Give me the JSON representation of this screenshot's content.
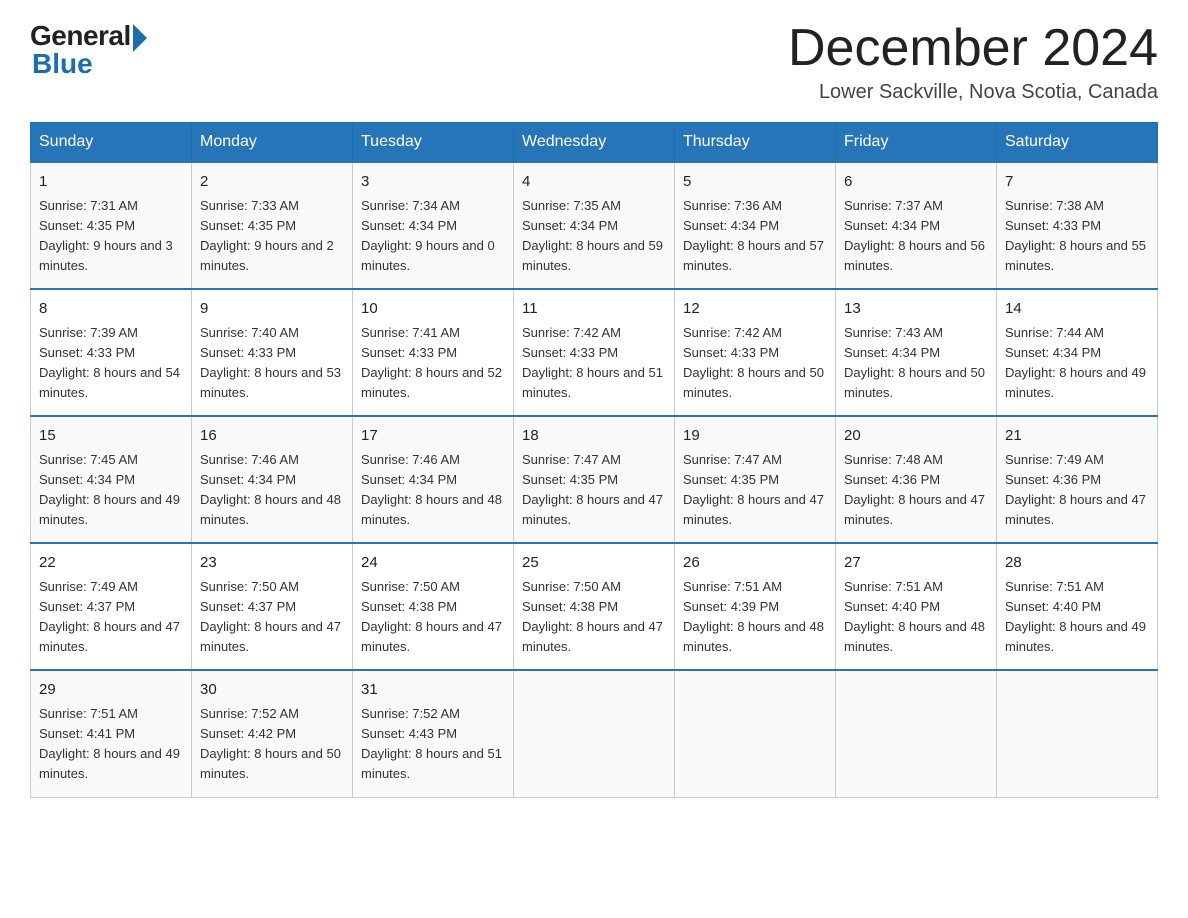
{
  "header": {
    "logo_general": "General",
    "logo_blue": "Blue",
    "month_title": "December 2024",
    "location": "Lower Sackville, Nova Scotia, Canada"
  },
  "weekdays": [
    "Sunday",
    "Monday",
    "Tuesday",
    "Wednesday",
    "Thursday",
    "Friday",
    "Saturday"
  ],
  "weeks": [
    [
      {
        "day": "1",
        "sunrise": "7:31 AM",
        "sunset": "4:35 PM",
        "daylight": "9 hours and 3 minutes."
      },
      {
        "day": "2",
        "sunrise": "7:33 AM",
        "sunset": "4:35 PM",
        "daylight": "9 hours and 2 minutes."
      },
      {
        "day": "3",
        "sunrise": "7:34 AM",
        "sunset": "4:34 PM",
        "daylight": "9 hours and 0 minutes."
      },
      {
        "day": "4",
        "sunrise": "7:35 AM",
        "sunset": "4:34 PM",
        "daylight": "8 hours and 59 minutes."
      },
      {
        "day": "5",
        "sunrise": "7:36 AM",
        "sunset": "4:34 PM",
        "daylight": "8 hours and 57 minutes."
      },
      {
        "day": "6",
        "sunrise": "7:37 AM",
        "sunset": "4:34 PM",
        "daylight": "8 hours and 56 minutes."
      },
      {
        "day": "7",
        "sunrise": "7:38 AM",
        "sunset": "4:33 PM",
        "daylight": "8 hours and 55 minutes."
      }
    ],
    [
      {
        "day": "8",
        "sunrise": "7:39 AM",
        "sunset": "4:33 PM",
        "daylight": "8 hours and 54 minutes."
      },
      {
        "day": "9",
        "sunrise": "7:40 AM",
        "sunset": "4:33 PM",
        "daylight": "8 hours and 53 minutes."
      },
      {
        "day": "10",
        "sunrise": "7:41 AM",
        "sunset": "4:33 PM",
        "daylight": "8 hours and 52 minutes."
      },
      {
        "day": "11",
        "sunrise": "7:42 AM",
        "sunset": "4:33 PM",
        "daylight": "8 hours and 51 minutes."
      },
      {
        "day": "12",
        "sunrise": "7:42 AM",
        "sunset": "4:33 PM",
        "daylight": "8 hours and 50 minutes."
      },
      {
        "day": "13",
        "sunrise": "7:43 AM",
        "sunset": "4:34 PM",
        "daylight": "8 hours and 50 minutes."
      },
      {
        "day": "14",
        "sunrise": "7:44 AM",
        "sunset": "4:34 PM",
        "daylight": "8 hours and 49 minutes."
      }
    ],
    [
      {
        "day": "15",
        "sunrise": "7:45 AM",
        "sunset": "4:34 PM",
        "daylight": "8 hours and 49 minutes."
      },
      {
        "day": "16",
        "sunrise": "7:46 AM",
        "sunset": "4:34 PM",
        "daylight": "8 hours and 48 minutes."
      },
      {
        "day": "17",
        "sunrise": "7:46 AM",
        "sunset": "4:34 PM",
        "daylight": "8 hours and 48 minutes."
      },
      {
        "day": "18",
        "sunrise": "7:47 AM",
        "sunset": "4:35 PM",
        "daylight": "8 hours and 47 minutes."
      },
      {
        "day": "19",
        "sunrise": "7:47 AM",
        "sunset": "4:35 PM",
        "daylight": "8 hours and 47 minutes."
      },
      {
        "day": "20",
        "sunrise": "7:48 AM",
        "sunset": "4:36 PM",
        "daylight": "8 hours and 47 minutes."
      },
      {
        "day": "21",
        "sunrise": "7:49 AM",
        "sunset": "4:36 PM",
        "daylight": "8 hours and 47 minutes."
      }
    ],
    [
      {
        "day": "22",
        "sunrise": "7:49 AM",
        "sunset": "4:37 PM",
        "daylight": "8 hours and 47 minutes."
      },
      {
        "day": "23",
        "sunrise": "7:50 AM",
        "sunset": "4:37 PM",
        "daylight": "8 hours and 47 minutes."
      },
      {
        "day": "24",
        "sunrise": "7:50 AM",
        "sunset": "4:38 PM",
        "daylight": "8 hours and 47 minutes."
      },
      {
        "day": "25",
        "sunrise": "7:50 AM",
        "sunset": "4:38 PM",
        "daylight": "8 hours and 47 minutes."
      },
      {
        "day": "26",
        "sunrise": "7:51 AM",
        "sunset": "4:39 PM",
        "daylight": "8 hours and 48 minutes."
      },
      {
        "day": "27",
        "sunrise": "7:51 AM",
        "sunset": "4:40 PM",
        "daylight": "8 hours and 48 minutes."
      },
      {
        "day": "28",
        "sunrise": "7:51 AM",
        "sunset": "4:40 PM",
        "daylight": "8 hours and 49 minutes."
      }
    ],
    [
      {
        "day": "29",
        "sunrise": "7:51 AM",
        "sunset": "4:41 PM",
        "daylight": "8 hours and 49 minutes."
      },
      {
        "day": "30",
        "sunrise": "7:52 AM",
        "sunset": "4:42 PM",
        "daylight": "8 hours and 50 minutes."
      },
      {
        "day": "31",
        "sunrise": "7:52 AM",
        "sunset": "4:43 PM",
        "daylight": "8 hours and 51 minutes."
      },
      null,
      null,
      null,
      null
    ]
  ],
  "labels": {
    "sunrise_prefix": "Sunrise: ",
    "sunset_prefix": "Sunset: ",
    "daylight_prefix": "Daylight: "
  }
}
